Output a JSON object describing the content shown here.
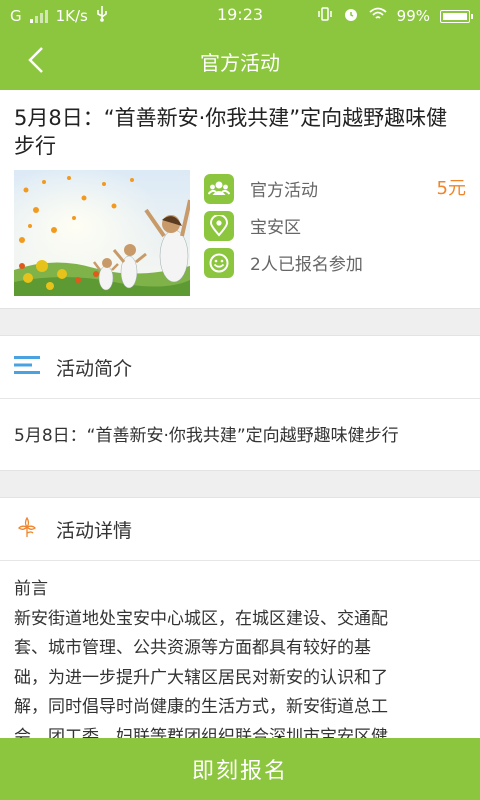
{
  "status": {
    "carrier": "G",
    "speed": "1K/s",
    "time": "19:23",
    "battery": "99%"
  },
  "nav": {
    "title": "官方活动"
  },
  "event": {
    "title": "5月8日：“首善新安·你我共建”定向越野趣味健步行",
    "category": "官方活动",
    "price": "5元",
    "location": "宝安区",
    "signups": "2人已报名参加"
  },
  "intro": {
    "heading": "活动简介",
    "text": "5月8日：“首善新安·你我共建”定向越野趣味健步行"
  },
  "details": {
    "heading": "活动详情",
    "preface": "前言",
    "lines": [
      "新安街道地处宝安中心城区，在城区建设、交通配",
      "套、城市管理、公共资源等方面都具有较好的基",
      "础，为进一步提升广大辖区居民对新安的认识和了",
      "解，同时倡导时尚健康的生活方式，新安街道总工",
      "会、团工委、妇联等群团组织联合深圳市宝安区健"
    ]
  },
  "action": {
    "signup_label": "即刻报名"
  },
  "colors": {
    "brand": "#8cc63f",
    "price": "#f0842a"
  }
}
